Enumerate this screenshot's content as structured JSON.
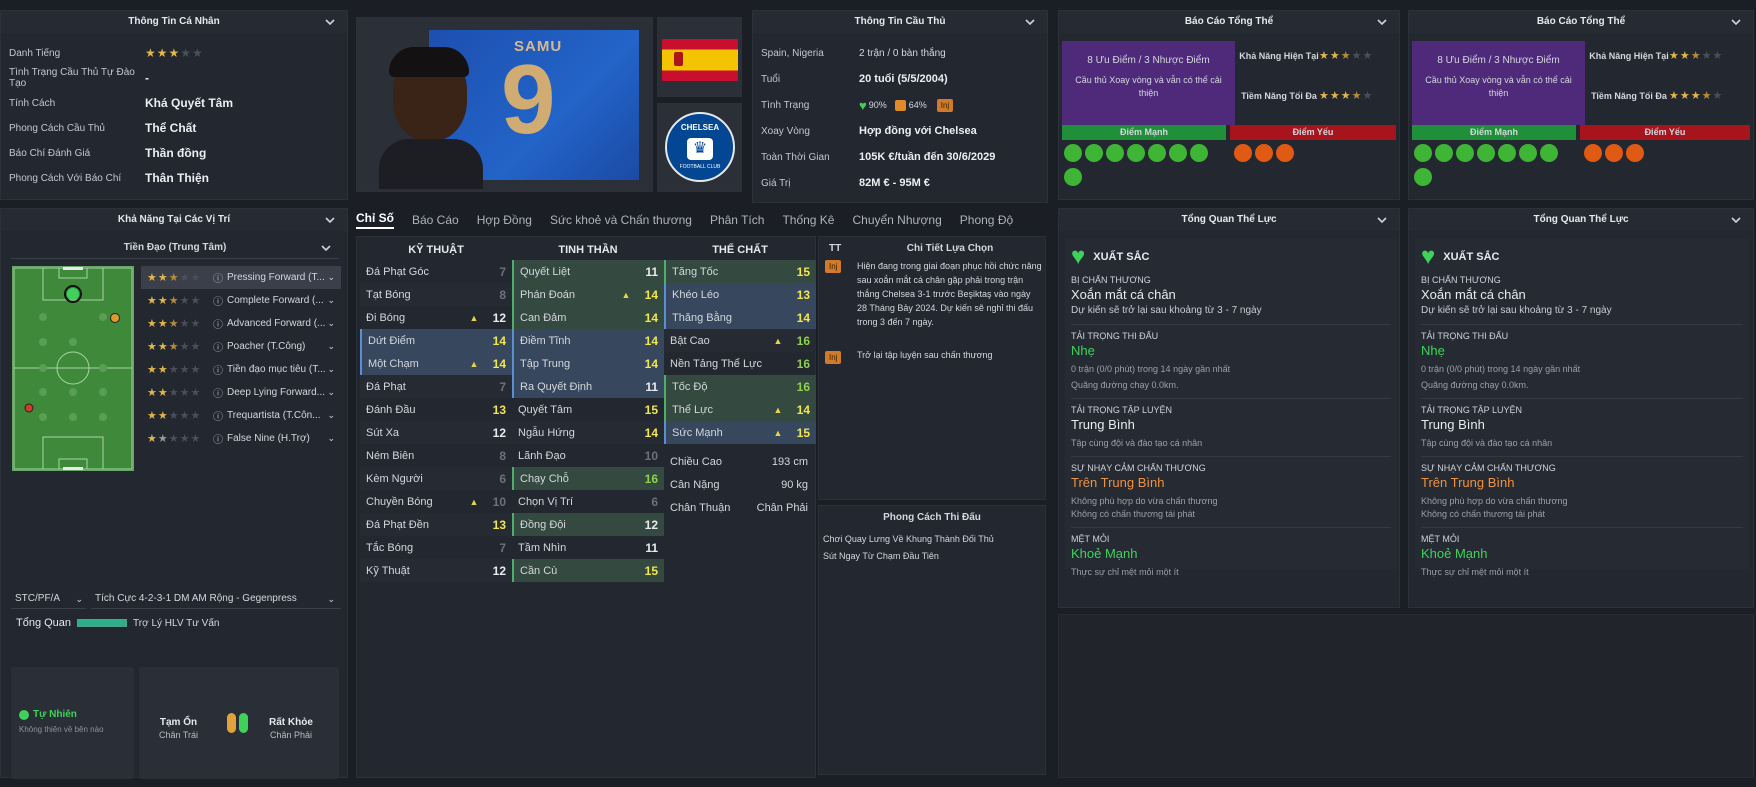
{
  "personal": {
    "title": "Thông Tin Cá Nhân",
    "rows": [
      {
        "label": "Danh Tiếng",
        "stars": 3
      },
      {
        "label": "Tình Trạng Cầu Thủ Tự Đào Tạo",
        "value": "-"
      },
      {
        "label": "Tính Cách",
        "value": "Khá Quyết Tâm"
      },
      {
        "label": "Phong Cách Cầu Thủ",
        "value": "Thể Chất"
      },
      {
        "label": "Báo Chí Đánh Giá",
        "value": "Thần đồng"
      },
      {
        "label": "Phong Cách Với Báo Chí",
        "value": "Thân Thiện"
      }
    ]
  },
  "positions": {
    "title": "Khả Năng Tại Các Vị Trí",
    "selected": "Tiền Đạo (Trung Tâm)",
    "roles": [
      {
        "name": "Pressing Forward (T...",
        "stars": 2.5
      },
      {
        "name": "Complete Forward (...",
        "stars": 2.5
      },
      {
        "name": "Advanced Forward (...",
        "stars": 2.5
      },
      {
        "name": "Poacher (T.Công)",
        "stars": 2.5
      },
      {
        "name": "Tiền đạo mục tiêu (T...",
        "stars": 2
      },
      {
        "name": "Deep Lying Forward...",
        "stars": 2
      },
      {
        "name": "Trequartista (T.Côn...",
        "stars": 2
      },
      {
        "name": "False Nine (H.Trợ)",
        "stars": 1.5
      }
    ],
    "role_code": "STC/PF/A",
    "tactic": "Tích Cực 4-2-3-1 DM AM Rộng - Gegenpress",
    "overview_label": "Tổng Quan",
    "advisor": "Trợ Lý HLV Tư Vấn"
  },
  "foot": {
    "natural": "Tự Nhiên",
    "natural_sub": "Không thiên về bên nào",
    "left_rating": "Tạm Ổn",
    "left_label": "Chân Trái",
    "right_rating": "Rất Khỏe",
    "right_label": "Chân Phải"
  },
  "player": {
    "shirt_name": "SAMU",
    "shirt_number": "9"
  },
  "club": {
    "badge_text": "CHELSEA",
    "badge_sub": "FOOTBALL CLUB"
  },
  "info": {
    "title": "Thông Tin Cầu Thủ",
    "nationality": "Spain, Nigeria",
    "caps": "2 trận / 0 bàn thắng",
    "age_label": "Tuổi",
    "age": "20 tuổi (5/5/2004)",
    "condition_label": "Tình Trạng",
    "condition": "90%",
    "sharpness": "64%",
    "inj_tag": "Inj",
    "rotation_label": "Xoay Vòng",
    "rotation": "Hợp đồng với Chelsea",
    "contract_label": "Toàn Thời Gian",
    "contract": "105K  €/tuần đến 30/6/2029",
    "value_label": "Giá Trị",
    "value": "82M  € - 95M  €"
  },
  "tabs": [
    "Chỉ Số",
    "Báo Cáo",
    "Hợp Đồng",
    "Sức khoẻ và Chấn thương",
    "Phân Tích",
    "Thống Kê",
    "Chuyển Nhượng",
    "Phong Độ"
  ],
  "attributes": {
    "technical_title": "KỸ THUẬT",
    "mental_title": "TINH THẦN",
    "physical_title": "THỂ CHẤT",
    "technical": [
      {
        "name": "Đá Phạt Góc",
        "value": "7",
        "hl": "",
        "tr": ""
      },
      {
        "name": "Tạt Bóng",
        "value": "8",
        "hl": "",
        "tr": ""
      },
      {
        "name": "Đi Bóng",
        "value": "12",
        "hl": "",
        "tr": "▲"
      },
      {
        "name": "Dứt Điểm",
        "value": "14",
        "hl": "bl",
        "tr": ""
      },
      {
        "name": "Một Chạm",
        "value": "14",
        "hl": "bl",
        "tr": "▲"
      },
      {
        "name": "Đá Phạt",
        "value": "7",
        "hl": "",
        "tr": ""
      },
      {
        "name": "Đánh Đầu",
        "value": "13",
        "hl": "",
        "tr": ""
      },
      {
        "name": "Sút Xa",
        "value": "12",
        "hl": "",
        "tr": ""
      },
      {
        "name": "Ném Biên",
        "value": "8",
        "hl": "",
        "tr": ""
      },
      {
        "name": "Kèm Người",
        "value": "6",
        "hl": "",
        "tr": ""
      },
      {
        "name": "Chuyền Bóng",
        "value": "10",
        "hl": "",
        "tr": "▲"
      },
      {
        "name": "Đá Phạt Đền",
        "value": "13",
        "hl": "",
        "tr": ""
      },
      {
        "name": "Tắc Bóng",
        "value": "7",
        "hl": "",
        "tr": ""
      },
      {
        "name": "Kỹ Thuật",
        "value": "12",
        "hl": "",
        "tr": ""
      }
    ],
    "mental": [
      {
        "name": "Quyết Liệt",
        "value": "11",
        "hl": "gr",
        "tr": ""
      },
      {
        "name": "Phán Đoán",
        "value": "14",
        "hl": "gr",
        "tr": "▲"
      },
      {
        "name": "Can Đảm",
        "value": "14",
        "hl": "gr",
        "tr": ""
      },
      {
        "name": "Điềm Tĩnh",
        "value": "14",
        "hl": "bl",
        "tr": ""
      },
      {
        "name": "Tập Trung",
        "value": "14",
        "hl": "bl",
        "tr": ""
      },
      {
        "name": "Ra Quyết Định",
        "value": "11",
        "hl": "bl",
        "tr": ""
      },
      {
        "name": "Quyết Tâm",
        "value": "15",
        "hl": "",
        "tr": ""
      },
      {
        "name": "Ngẫu Hứng",
        "value": "14",
        "hl": "",
        "tr": ""
      },
      {
        "name": "Lãnh Đạo",
        "value": "10",
        "hl": "",
        "tr": ""
      },
      {
        "name": "Chạy Chỗ",
        "value": "16",
        "hl": "gr",
        "tr": ""
      },
      {
        "name": "Chọn Vị Trí",
        "value": "6",
        "hl": "",
        "tr": ""
      },
      {
        "name": "Đồng Đội",
        "value": "12",
        "hl": "gr",
        "tr": ""
      },
      {
        "name": "Tầm Nhìn",
        "value": "11",
        "hl": "",
        "tr": ""
      },
      {
        "name": "Cần Cù",
        "value": "15",
        "hl": "gr",
        "tr": ""
      }
    ],
    "physical": [
      {
        "name": "Tăng Tốc",
        "value": "15",
        "hl": "gr",
        "tr": ""
      },
      {
        "name": "Khéo Léo",
        "value": "13",
        "hl": "bl",
        "tr": ""
      },
      {
        "name": "Thăng Bằng",
        "value": "14",
        "hl": "bl",
        "tr": ""
      },
      {
        "name": "Bật Cao",
        "value": "16",
        "hl": "",
        "tr": "▲"
      },
      {
        "name": "Nền Tảng Thể Lực",
        "value": "16",
        "hl": "",
        "tr": ""
      },
      {
        "name": "Tốc Độ",
        "value": "16",
        "hl": "gr",
        "tr": ""
      },
      {
        "name": "Thể Lực",
        "value": "14",
        "hl": "gr",
        "tr": "▲"
      },
      {
        "name": "Sức Mạnh",
        "value": "15",
        "hl": "bl",
        "tr": "▲"
      }
    ],
    "height_label": "Chiều Cao",
    "height": "193 cm",
    "weight_label": "Cân Nặng",
    "weight": "90 kg",
    "foot_label": "Chân Thuận",
    "foot": "Chân Phải"
  },
  "selection": {
    "tt": "TT",
    "title": "Chi Tiết Lựa Chọn",
    "inj": "Inj",
    "text1": "Hiện đang trong giai đoạn phục hồi chức năng sau xoắn mắt cá chân gặp phải trong trận thắng Chelsea 3-1 trước Beşiktaş vào ngày 28 Tháng Bảy 2024. Dự kiến sẽ nghỉ thi đấu trong 3 đến 7 ngày.",
    "text2": "Trở lại tập luyện sau chấn thương"
  },
  "style": {
    "title": "Phong Cách Thi Đấu",
    "items": [
      "Chơi Quay Lưng Về Khung Thành Đối Thủ",
      "Sút Ngay Từ Chạm Đầu Tiên"
    ]
  },
  "report": {
    "title": "Báo Cáo Tổng Thể",
    "summary": "8 Ưu Điểm / 3 Nhược Điểm",
    "desc": "Cầu thủ Xoay vòng và vẫn có thể cải thiện",
    "current_label": "Khả Năng Hiện Tại",
    "potential_label": "Tiềm Năng Tối Đa",
    "current_stars": 2.5,
    "potential_stars": 3.5,
    "strengths_label": "Điểm Mạnh",
    "weakness_label": "Điểm Yếu"
  },
  "fitness": {
    "title": "Tổng Quan Thể Lực",
    "status": "XUẤT SẮC",
    "injury_label": "BỊ CHẤN THƯƠNG",
    "injury": "Xoắn mắt cá chân",
    "injury_sub": "Dự kiến sẽ trở lại sau khoảng từ 3 - 7 ngày",
    "match_load_label": "TẢI TRỌNG THI ĐẤU",
    "match_load": "Nhẹ",
    "match_load_sub1": "0 trận (0/0 phút) trong 14 ngày gần nhất",
    "match_load_sub2": "Quãng đường chạy 0.0km.",
    "training_load_label": "TẢI TRỌNG TẬP LUYỆN",
    "training_load": "Trung Bình",
    "training_load_sub": "Tập cùng đội và đào tạo cá nhân",
    "injury_prone_label": "SỰ NHẠY CẢM CHẤN THƯƠNG",
    "injury_prone": "Trên Trung Bình",
    "injury_prone_sub1": "Không phù hợp do vừa chấn thương",
    "injury_prone_sub2": "Không có chấn thương tái phát",
    "fatigue_label": "MỆT MỎI",
    "fatigue": "Khoẻ Mạnh",
    "fatigue_sub": "Thực sự chỉ mệt mỏi một ít"
  },
  "colors": {
    "green": "#3fd25a",
    "orange": "#f0923a",
    "gold": "#e2b64a",
    "purple": "#4f2a7a",
    "strength": "#1f8f3a",
    "weakness": "#a8141c"
  }
}
